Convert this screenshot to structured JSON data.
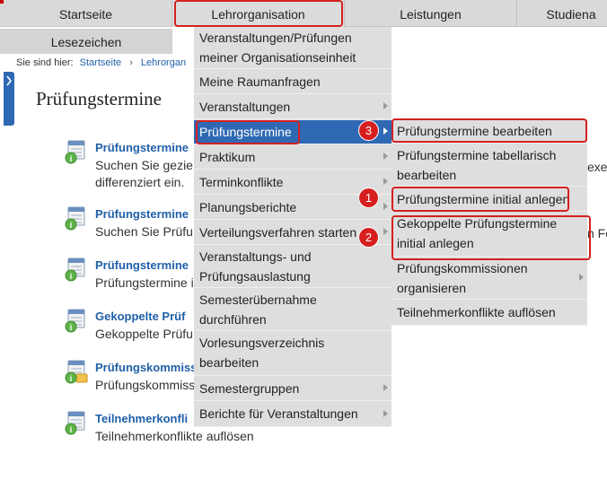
{
  "topnav": {
    "items": [
      "Startseite",
      "Lehrorganisation",
      "Leistungen",
      "Studiena"
    ]
  },
  "bookmarks_label": "Lesezeichen",
  "breadcrumb": {
    "prefix": "Sie sind hier:",
    "home": "Startseite",
    "current": "Lehrorgan"
  },
  "page_title": "Prüfungstermine",
  "entries": [
    {
      "title": "Prüfungstermine",
      "desc": "Suchen Sie gezie",
      "desc2": "differenziert ein.",
      "icon": "calendar-info-icon"
    },
    {
      "title": "Prüfungstermine",
      "desc": "Suchen Sie Prüfu",
      "icon": "calendar-info-icon"
    },
    {
      "title": "Prüfungstermine",
      "desc": "Prüfungstermine i",
      "icon": "calendar-info-icon"
    },
    {
      "title": "Gekoppelte Prüf",
      "desc": "Gekoppelte Prüfu",
      "icon": "calendar-info-icon"
    },
    {
      "title": "Prüfungskommiss",
      "desc": "Prüfungskommiss",
      "icon": "calendar-folder-icon"
    },
    {
      "title": "Teilnehmerkonfli",
      "desc": "Teilnehmerkonflikte auflösen",
      "icon": "calendar-info-icon"
    }
  ],
  "right_fragments": [
    "exe",
    "n Fo"
  ],
  "menu1": {
    "items": [
      {
        "lines": [
          "Veranstaltungen/Prüfungen",
          "meiner Organisationseinheit"
        ],
        "submenu": false
      },
      {
        "lines": [
          "Meine Raumanfragen"
        ],
        "submenu": false
      },
      {
        "lines": [
          "Veranstaltungen"
        ],
        "submenu": true
      },
      {
        "lines": [
          "Prüfungstermine"
        ],
        "submenu": true,
        "highlighted": true
      },
      {
        "lines": [
          "Praktikum"
        ],
        "submenu": true
      },
      {
        "lines": [
          "Terminkonflikte"
        ],
        "submenu": true
      },
      {
        "lines": [
          "Planungsberichte"
        ],
        "submenu": true
      },
      {
        "lines": [
          "Verteilungsverfahren starten"
        ],
        "submenu": true
      },
      {
        "lines": [
          "Veranstaltungs- und",
          "Prüfungsauslastung"
        ],
        "submenu": false
      },
      {
        "lines": [
          "Semesterübernahme",
          "durchführen"
        ],
        "submenu": false
      },
      {
        "lines": [
          "Vorlesungsverzeichnis",
          "bearbeiten"
        ],
        "submenu": false
      },
      {
        "lines": [
          "Semestergruppen"
        ],
        "submenu": true
      },
      {
        "lines": [
          "Berichte für Veranstaltungen"
        ],
        "submenu": true
      }
    ]
  },
  "menu2": {
    "items": [
      {
        "lines": [
          "Prüfungstermine bearbeiten"
        ],
        "submenu": false
      },
      {
        "lines": [
          "Prüfungstermine tabellarisch",
          "bearbeiten"
        ],
        "submenu": false
      },
      {
        "lines": [
          "Prüfungstermine initial anlegen"
        ],
        "submenu": false
      },
      {
        "lines": [
          "Gekoppelte Prüfungstermine",
          "initial anlegen"
        ],
        "submenu": false
      },
      {
        "lines": [
          "Prüfungskommissionen",
          "organisieren"
        ],
        "submenu": true
      },
      {
        "lines": [
          "Teilnehmerkonflikte auflösen"
        ],
        "submenu": false
      }
    ]
  },
  "badges": [
    "1",
    "2",
    "3"
  ],
  "colors": {
    "highlight": "#2f69b4",
    "annotation": "#d42020",
    "link": "#1f5fa8"
  }
}
